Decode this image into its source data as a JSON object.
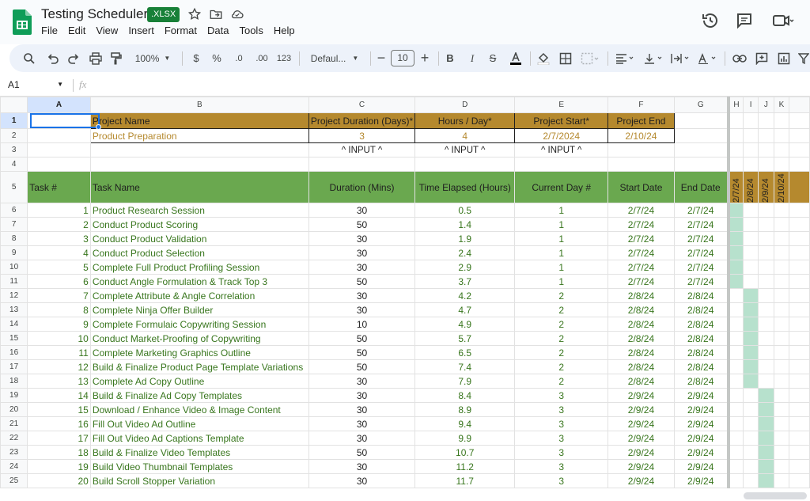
{
  "app": {
    "title": "Testing Scheduler",
    "badge": ".XLSX"
  },
  "menu": [
    "File",
    "Edit",
    "View",
    "Insert",
    "Format",
    "Data",
    "Tools",
    "Help"
  ],
  "toolbar": {
    "zoom": "100%",
    "currency": "$",
    "percent": "%",
    "dec_dec": ".0",
    "dec_inc": ".00",
    "num_format": "123",
    "font": "Defaul...",
    "font_size": "10"
  },
  "formula_bar": {
    "cell_ref": "A1",
    "fx": "fx",
    "value": ""
  },
  "columns": [
    "A",
    "B",
    "C",
    "D",
    "E",
    "F",
    "G",
    "H",
    "I",
    "J",
    "K"
  ],
  "row_numbers": [
    "1",
    "2",
    "3",
    "4",
    "5",
    "6",
    "7",
    "8",
    "9",
    "10",
    "11",
    "12",
    "13",
    "14",
    "15",
    "16",
    "17",
    "18",
    "19",
    "20",
    "21",
    "22",
    "23",
    "24",
    "25"
  ],
  "project": {
    "headers": [
      "Project Name",
      "Project Duration (Days)*",
      "Hours / Day*",
      "Project Start*",
      "Project End"
    ],
    "values": [
      "Product Preparation",
      "3",
      "4",
      "2/7/2024",
      "2/10/24"
    ],
    "input_label": "^ INPUT ^"
  },
  "task_headers": [
    "Task #",
    "Task Name",
    "Duration (Mins)",
    "Time Elapsed (Hours)",
    "Current Day #",
    "Start Date",
    "End Date"
  ],
  "gantt_dates": [
    "2/7/24",
    "2/8/24",
    "2/9/24",
    "2/10/24"
  ],
  "tasks": [
    [
      "1",
      "Product Research Session",
      "30",
      "0.5",
      "1",
      "2/7/24",
      "2/7/24"
    ],
    [
      "2",
      "Conduct Product Scoring",
      "50",
      "1.4",
      "1",
      "2/7/24",
      "2/7/24"
    ],
    [
      "3",
      "Conduct Product Validation",
      "30",
      "1.9",
      "1",
      "2/7/24",
      "2/7/24"
    ],
    [
      "4",
      "Conduct Product Selection",
      "30",
      "2.4",
      "1",
      "2/7/24",
      "2/7/24"
    ],
    [
      "5",
      "Complete Full Product Profiling Session",
      "30",
      "2.9",
      "1",
      "2/7/24",
      "2/7/24"
    ],
    [
      "6",
      "Conduct Angle Formulation & Track Top 3",
      "50",
      "3.7",
      "1",
      "2/7/24",
      "2/7/24"
    ],
    [
      "7",
      "Complete Attribute & Angle Correlation",
      "30",
      "4.2",
      "2",
      "2/8/24",
      "2/8/24"
    ],
    [
      "8",
      "Complete Ninja Offer Builder",
      "30",
      "4.7",
      "2",
      "2/8/24",
      "2/8/24"
    ],
    [
      "9",
      "Complete Formulaic Copywriting Session",
      "10",
      "4.9",
      "2",
      "2/8/24",
      "2/8/24"
    ],
    [
      "10",
      "Conduct Market-Proofing of Copywriting",
      "50",
      "5.7",
      "2",
      "2/8/24",
      "2/8/24"
    ],
    [
      "11",
      "Complete Marketing Graphics Outline",
      "50",
      "6.5",
      "2",
      "2/8/24",
      "2/8/24"
    ],
    [
      "12",
      "Build & Finalize Product Page Template Variations",
      "50",
      "7.4",
      "2",
      "2/8/24",
      "2/8/24"
    ],
    [
      "13",
      "Complete Ad Copy Outline",
      "30",
      "7.9",
      "2",
      "2/8/24",
      "2/8/24"
    ],
    [
      "14",
      "Build & Finalize Ad Copy Templates",
      "30",
      "8.4",
      "3",
      "2/9/24",
      "2/9/24"
    ],
    [
      "15",
      "Download / Enhance Video & Image Content",
      "30",
      "8.9",
      "3",
      "2/9/24",
      "2/9/24"
    ],
    [
      "16",
      "Fill Out Video Ad Outline",
      "30",
      "9.4",
      "3",
      "2/9/24",
      "2/9/24"
    ],
    [
      "17",
      "Fill Out Video Ad Captions Template",
      "30",
      "9.9",
      "3",
      "2/9/24",
      "2/9/24"
    ],
    [
      "18",
      "Build & Finalize Video Templates",
      "50",
      "10.7",
      "3",
      "2/9/24",
      "2/9/24"
    ],
    [
      "19",
      "Build Video Thumbnail Templates",
      "30",
      "11.2",
      "3",
      "2/9/24",
      "2/9/24"
    ],
    [
      "20",
      "Build Scroll Stopper Variation",
      "30",
      "11.7",
      "3",
      "2/9/24",
      "2/9/24"
    ]
  ],
  "colors": {
    "gold": "#b5892e",
    "green": "#6aa84f",
    "gantt": "#b7e1cd",
    "text_green": "#38761d",
    "selection": "#1a73e8"
  }
}
